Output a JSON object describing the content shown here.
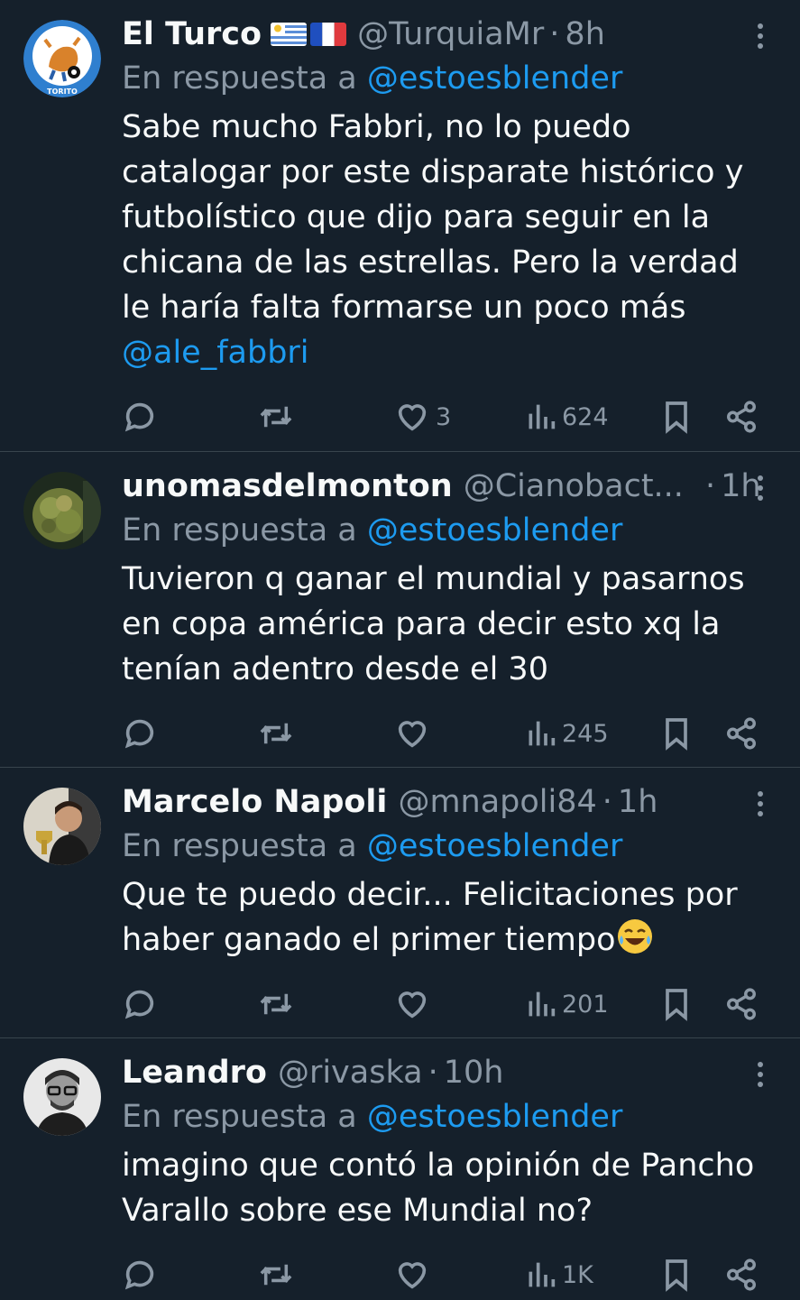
{
  "tweets": [
    {
      "name": "El Turco",
      "handle": "@TurquiaMr",
      "time": "8h",
      "reply_prefix": "En respuesta a",
      "reply_to": "@estoesblender",
      "text": "Sabe mucho Fabbri, no lo puedo catalogar por este disparate histórico y futbolístico que dijo para seguir en la chicana de las estrellas. Pero la verdad le haría falta formarse un poco más",
      "text_mention": "@ale_fabbri",
      "avatar_label": "TORITO",
      "likes": "3",
      "views": "624"
    },
    {
      "name": "unomasdelmonton",
      "handle": "@Cianobact...",
      "time": "1h",
      "reply_prefix": "En respuesta a",
      "reply_to": "@estoesblender",
      "text": "Tuvieron q ganar el mundial y pasarnos en copa américa para decir esto xq la tenían adentro desde el 30",
      "likes": "",
      "views": "245"
    },
    {
      "name": "Marcelo Napoli",
      "handle": "@mnapoli84",
      "time": "1h",
      "reply_prefix": "En respuesta a",
      "reply_to": "@estoesblender",
      "text": "Que te puedo decir... Felicitaciones por haber ganado el primer tiempo",
      "likes": "",
      "views": "201"
    },
    {
      "name": "Leandro",
      "handle": "@rivaska",
      "time": "10h",
      "reply_prefix": "En respuesta a",
      "reply_to": "@estoesblender",
      "text": "imagino que contó la opinión de Pancho Varallo sobre ese Mundial no?",
      "likes": "",
      "views": "1K"
    }
  ],
  "separator": "·",
  "colors": {
    "background": "#15202b",
    "text": "#f7f9f9",
    "muted": "#8b98a5",
    "link": "#1d9bf0",
    "divider": "#38444d"
  }
}
